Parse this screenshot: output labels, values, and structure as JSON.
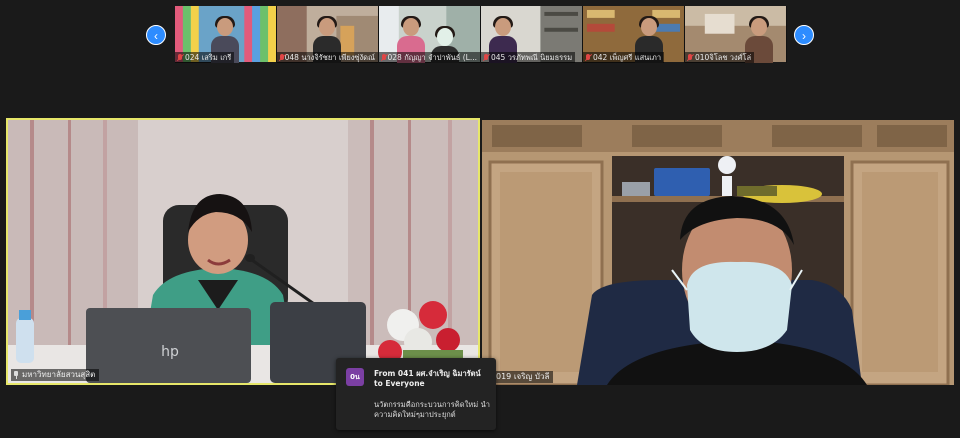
{
  "gallery": {
    "prev_label": "‹",
    "next_label": "›",
    "thumbnails": [
      {
        "label": "024 เสริม เกรี",
        "bg": "#6aa3c8",
        "shirt": "#4a4a5a"
      },
      {
        "label": "048 นางจิรัชยา เพียงซุ่งัดณ์",
        "bg": "#8e6e5e",
        "shirt": "#2b2b2b"
      },
      {
        "label": "028 กัญญา จำปาพันธ์ (L...",
        "bg": "#9fb0a8",
        "shirt": "#d96b8f"
      },
      {
        "label": "045 วรภัทพณี นิยมธรรม",
        "bg": "#7b7a74",
        "shirt": "#3d2a4f"
      },
      {
        "label": "042 เพ็ญศรี แสนเภา",
        "bg": "#8f6a3c",
        "shirt": "#2a2a2a"
      },
      {
        "label": "010จิโลช วงศ์โล่",
        "bg": "#a48a6f",
        "shirt": "#6b4a3a"
      }
    ]
  },
  "main_videos": {
    "left": {
      "label": "มหาวิทยาลัยสวนสุสิต"
    },
    "right": {
      "label": "019 เจริญ บัวลี"
    }
  },
  "chat_toast": {
    "avatar_initials": "0น",
    "from": "From 041 ผศ.จำเริญ ฉิมารัตน์",
    "to": "to Everyone",
    "message": "นวัตกรรมคือกระบวนการคิดใหม่ นำความคิดใหม่ๆมาประยุกต์"
  },
  "colors": {
    "active_speaker_border": "#e7e76a",
    "nav_button": "#2d8cff",
    "avatar": "#7b3fa3"
  }
}
